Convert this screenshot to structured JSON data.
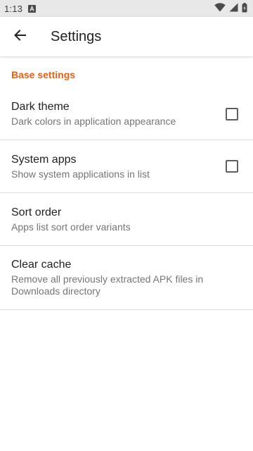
{
  "status_bar": {
    "time": "1:13",
    "notification_icon": "a-notification-icon",
    "wifi_icon": "wifi-icon",
    "signal_icon": "signal-icon",
    "battery_icon": "battery-icon"
  },
  "app_bar": {
    "back_icon": "arrow-back-icon",
    "title": "Settings"
  },
  "section": {
    "header": "Base settings",
    "accent_color": "#e8611a"
  },
  "preferences": [
    {
      "title": "Dark theme",
      "summary": "Dark colors in application appearance",
      "has_checkbox": true,
      "checked": false
    },
    {
      "title": "System apps",
      "summary": "Show system applications in list",
      "has_checkbox": true,
      "checked": false
    },
    {
      "title": "Sort order",
      "summary": "Apps list sort order variants",
      "has_checkbox": false
    },
    {
      "title": "Clear cache",
      "summary": "Remove all previously extracted APK files in Downloads directory",
      "has_checkbox": false
    }
  ]
}
